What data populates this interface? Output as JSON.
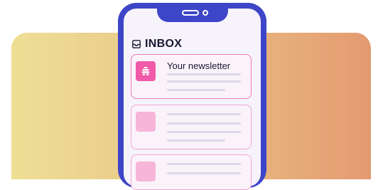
{
  "inbox": {
    "title": "INBOX",
    "messages": [
      {
        "subject": "Your newsletter",
        "state": "highlighted"
      },
      {
        "subject": "",
        "state": "placeholder"
      },
      {
        "subject": "",
        "state": "placeholder"
      }
    ]
  },
  "colors": {
    "phone_frame": "#3d45c8",
    "accent_pink": "#f05aa8",
    "card_border": "#f0a6d0",
    "backdrop_gradient": [
      "#eedf95",
      "#e49a70"
    ]
  },
  "icons": {
    "inbox": "inbox-tray-icon",
    "newsletter": "beehive-icon"
  }
}
